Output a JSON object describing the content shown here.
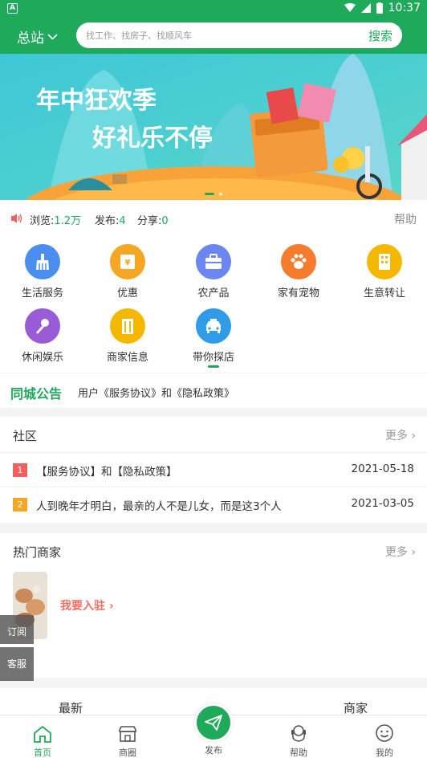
{
  "status_bar": {
    "time": "10:37",
    "app_badge": "A"
  },
  "header": {
    "city": "总站",
    "search_placeholder": "找工作、找房子、找顺风车",
    "search_button": "搜索"
  },
  "banner": {
    "headline_1": "年中狂欢季",
    "headline_2": "好礼乐不停",
    "slide_count": 2,
    "active_slide": 1
  },
  "stats": {
    "views_label": "浏览:",
    "views_value": "1.2万",
    "posts_label": "发布:",
    "posts_value": "4",
    "shares_label": "分享:",
    "shares_value": "0",
    "help": "帮助"
  },
  "categories": [
    {
      "label": "生活服务",
      "icon": "broom-icon",
      "color": "#4a8ef0"
    },
    {
      "label": "优惠",
      "icon": "ticket-icon",
      "color": "#f5a623"
    },
    {
      "label": "农产品",
      "icon": "briefcase-icon",
      "color": "#6b86f0"
    },
    {
      "label": "家有宠物",
      "icon": "paw-icon",
      "color": "#f47c2c"
    },
    {
      "label": "生意转让",
      "icon": "building-icon",
      "color": "#f5b800"
    },
    {
      "label": "休闲娱乐",
      "icon": "microphone-icon",
      "color": "#9a5cd6"
    },
    {
      "label": "商家信息",
      "icon": "store-icon",
      "color": "#f5b800"
    },
    {
      "label": "带你探店",
      "icon": "car-icon",
      "color": "#2f9ce8"
    }
  ],
  "notice": {
    "label": "同城公告",
    "text": "用户《服务协议》和《隐私政策》"
  },
  "community": {
    "title": "社区",
    "more": "更多",
    "posts": [
      {
        "rank": "1",
        "title": "【服务协议】和【隐私政策】",
        "date": "2021-05-18",
        "color": "#f0605c"
      },
      {
        "rank": "2",
        "title": "人到晚年才明白，最亲的人不是儿女，而是这3个人",
        "date": "2021-03-05",
        "color": "#f5a623"
      }
    ]
  },
  "merchants": {
    "title": "热门商家",
    "more": "更多",
    "join": "我要入驻"
  },
  "floating": {
    "subscribe": "订阅",
    "service": "客服"
  },
  "feed_tabs": {
    "latest": "最新",
    "merchant": "商家"
  },
  "bottom_nav": {
    "home": "首页",
    "circle": "商圈",
    "publish": "发布",
    "help": "帮助",
    "mine": "我的"
  },
  "colors": {
    "brand_green": "#1fa95a",
    "accent_red": "#f07066"
  }
}
